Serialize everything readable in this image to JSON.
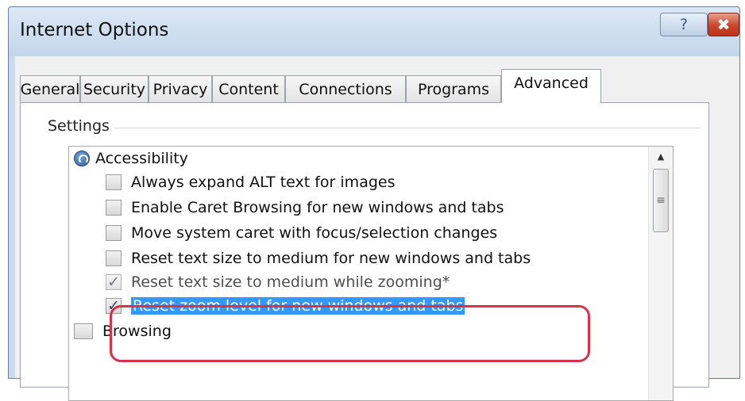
{
  "window": {
    "title": "Internet Options",
    "help_glyph": "?",
    "close_glyph": "✖"
  },
  "tabs": [
    {
      "label": "General"
    },
    {
      "label": "Security"
    },
    {
      "label": "Privacy"
    },
    {
      "label": "Content"
    },
    {
      "label": "Connections"
    },
    {
      "label": "Programs"
    },
    {
      "label": "Advanced",
      "active": true
    }
  ],
  "settings": {
    "group_label": "Settings",
    "category": {
      "label": "Accessibility",
      "icon": "accessibility-icon"
    },
    "items": [
      {
        "label": "Always expand ALT text for images",
        "checked": false
      },
      {
        "label": "Enable Caret Browsing for new windows and tabs",
        "checked": false
      },
      {
        "label": "Move system caret with focus/selection changes",
        "checked": false
      },
      {
        "label": "Reset text size to medium for new windows and tabs",
        "checked": false
      },
      {
        "label": "Reset text size to medium while zooming*",
        "checked": true
      },
      {
        "label": "Reset zoom level for new windows and tabs",
        "checked": true,
        "selected": true
      }
    ],
    "next_category": {
      "label": "Browsing"
    },
    "check_glyph": "✓"
  },
  "colors": {
    "selection": "#3399ff",
    "highlight_outline": "#d6334a",
    "close_button": "#c9452b"
  }
}
